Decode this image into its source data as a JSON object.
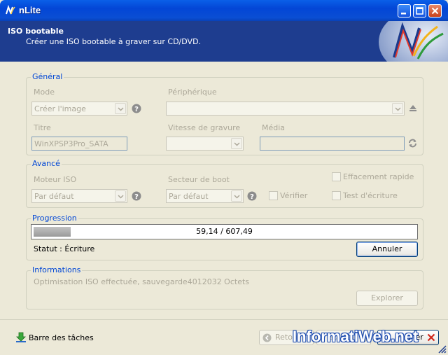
{
  "window": {
    "title": "nLite"
  },
  "header": {
    "title": "ISO bootable",
    "subtitle": "Créer une ISO bootable à graver sur CD/DVD."
  },
  "general": {
    "legend": "Général",
    "mode_label": "Mode",
    "mode_value": "Créer l'image",
    "device_label": "Périphérique",
    "device_value": "",
    "title_label": "Titre",
    "title_value": "WinXPSP3Pro_SATA",
    "speed_label": "Vitesse de gravure",
    "speed_value": "",
    "media_label": "Média",
    "media_value": ""
  },
  "advanced": {
    "legend": "Avancé",
    "iso_engine_label": "Moteur ISO",
    "iso_engine_value": "Par défaut",
    "boot_sector_label": "Secteur de boot",
    "boot_sector_value": "Par défaut",
    "verify_label": "Vérifier",
    "quick_erase_label": "Effacement rapide",
    "write_test_label": "Test d'écriture"
  },
  "progress": {
    "legend": "Progression",
    "text": "59,14 / 607,49",
    "fraction": 0.0974,
    "status": "Statut : Écriture",
    "cancel_label": "Annuler"
  },
  "info": {
    "legend": "Informations",
    "text": "Optimisation ISO effectuée, sauvegarde4012032 Octets",
    "explore_label": "Explorer"
  },
  "footer": {
    "taskbar_label": "Barre des tâches",
    "back_label": "Retour",
    "next_label": "Suivant",
    "close_label": "Fermer"
  },
  "watermark": "InformatiWeb.net",
  "colors": {
    "header_bg": "#1E3D8F",
    "legend": "#0046D5",
    "titlebar": "#0A4ED3"
  }
}
